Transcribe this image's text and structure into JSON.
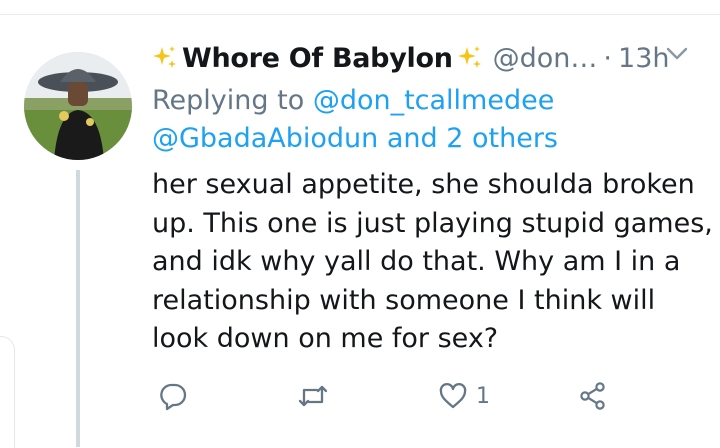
{
  "tweet": {
    "display_name": "Whore Of Babylon",
    "handle": "@don…",
    "separator": "·",
    "time": "13h",
    "replying_to_prefix": "Replying to",
    "replying_to_user": "@don_tcallmedee",
    "replying_to_more": "@GbadaAbiodun and 2 others",
    "body_lines": [
      "her sexual appetite, she shoulda broken",
      "up. This one is just playing stupid games,",
      "and idk why yall do that. Why am I in a",
      "relationship with someone I think will",
      "look down on me for sex?"
    ],
    "like_count": "1"
  },
  "colors": {
    "text": "#14171a",
    "secondary": "#657786",
    "link": "#1da1f2",
    "sparkle": "#f5c518",
    "divider": "#e6ecf0"
  },
  "icons": [
    "sparkle-icon",
    "chevron-down-icon",
    "reply-icon",
    "retweet-icon",
    "heart-icon",
    "share-icon"
  ]
}
